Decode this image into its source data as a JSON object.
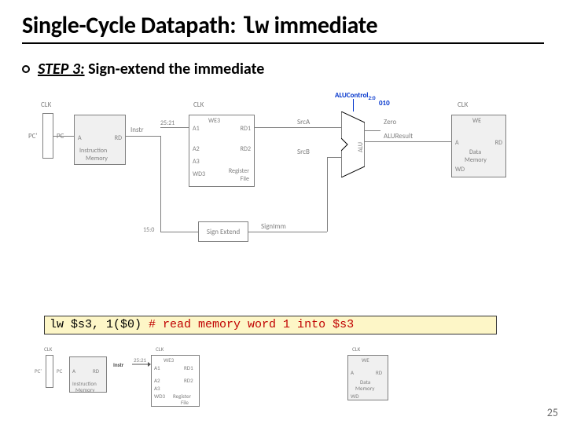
{
  "title_prefix": "Single-Cycle Datapath: ",
  "title_mono": "lw",
  "title_suffix": " immediate",
  "bullet": {
    "step_label": "STEP 3:",
    "step_text": " Sign-extend the immediate"
  },
  "diagram": {
    "clk": "CLK",
    "pc_in": "PC'",
    "pc_out": "PC",
    "imem_a": "A",
    "imem_rd": "RD",
    "imem_name": "Instruction",
    "imem_name2": "Memory",
    "instr": "Instr",
    "bits_rs": "25:21",
    "bits_imm": "15:0",
    "rf": "Register",
    "rf2": "File",
    "rf_a1": "A1",
    "rf_a2": "A2",
    "rf_a3": "A3",
    "rf_wd3": "WD3",
    "rf_we3": "WE3",
    "rf_rd1": "RD1",
    "rf_rd2": "RD2",
    "signext": "Sign Extend",
    "signimm": "SignImm",
    "srca": "SrcA",
    "srcb": "SrcB",
    "alu": "ALU",
    "aluctrl": "ALUControl",
    "aluctrl_sub": "2:0",
    "aluctrl_val": "010",
    "zero": "Zero",
    "alures": "ALUResult",
    "dmem_name": "Data",
    "dmem_name2": "Memory",
    "dmem_a": "A",
    "dmem_rd": "RD",
    "dmem_we": "WE",
    "dmem_wd": "WD"
  },
  "code": {
    "instr": "lw $s3, 1($0)  ",
    "comment": "# read memory word 1 into $s3"
  },
  "lower": {
    "clk": "CLK",
    "pc_in": "PC'",
    "pc_out": "PC",
    "imem_name": "Instruction",
    "imem_name2": "Memory",
    "imem_a": "A",
    "imem_rd": "RD",
    "instr": "Instr",
    "rf_a1": "A1",
    "rf_a2": "A2",
    "rf_a3": "A3",
    "rf_wd3": "WD3",
    "rf_we3": "WE3",
    "rf_rd1": "RD1",
    "rf_rd2": "RD2",
    "rf": "Register",
    "rf2": "File",
    "bits_rs": "25:21",
    "dmem_name": "Data",
    "dmem_name2": "Memory",
    "dmem_a": "A",
    "dmem_rd": "RD",
    "dmem_we": "WE",
    "dmem_wd": "WD"
  },
  "pagenum": "25"
}
